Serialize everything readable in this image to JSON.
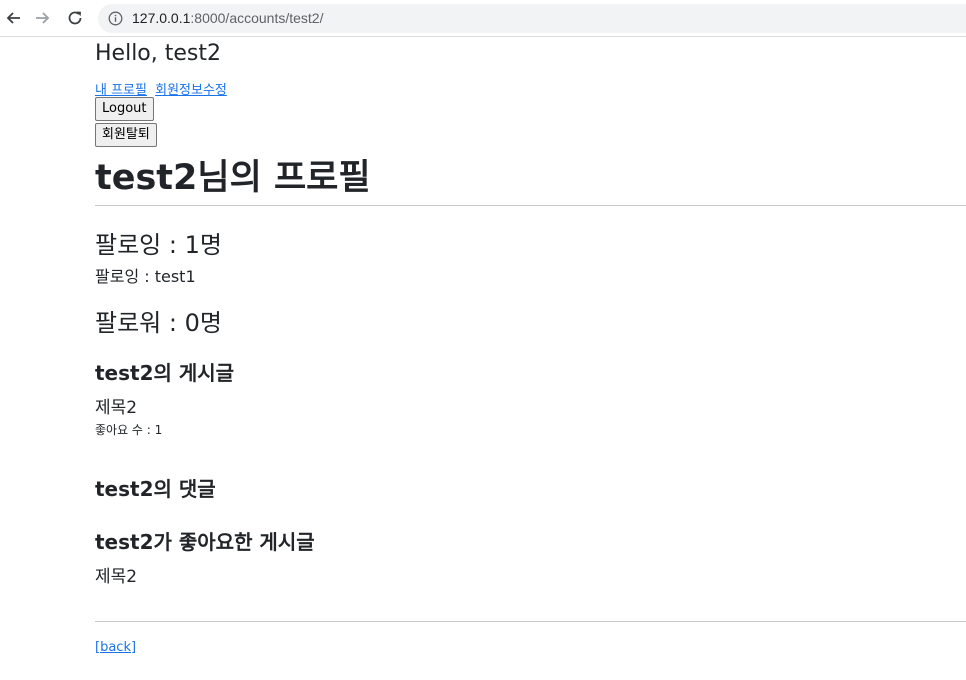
{
  "browser": {
    "url_host": "127.0.0.1",
    "url_path": ":8000/accounts/test2/",
    "back_icon": "arrow-left-icon",
    "forward_icon": "arrow-right-icon",
    "reload_icon": "reload-icon",
    "info_icon": "info-icon"
  },
  "header": {
    "greeting": "Hello, test2",
    "links": {
      "my_profile": "내 프로필",
      "edit_info": "회원정보수정"
    },
    "logout_label": "Logout",
    "withdraw_label": "회원탈퇴"
  },
  "profile": {
    "title": "test2님의 프로필",
    "following_count": "팔로잉 : 1명",
    "following_list": "팔로잉 : test1",
    "follower_count": "팔로워 : 0명"
  },
  "posts": {
    "heading": "test2의 게시글",
    "items": [
      {
        "title": "제목2",
        "likes": "좋아요 수 : 1"
      }
    ]
  },
  "comments": {
    "heading": "test2의 댓글"
  },
  "liked_posts": {
    "heading": "test2가 좋아요한 게시글",
    "items": [
      {
        "title": "제목2"
      }
    ]
  },
  "footer": {
    "back_label": "[back]"
  },
  "colors": {
    "link": "#1a73e8",
    "text": "#212529",
    "omnibox_bg": "#f1f3f4"
  }
}
